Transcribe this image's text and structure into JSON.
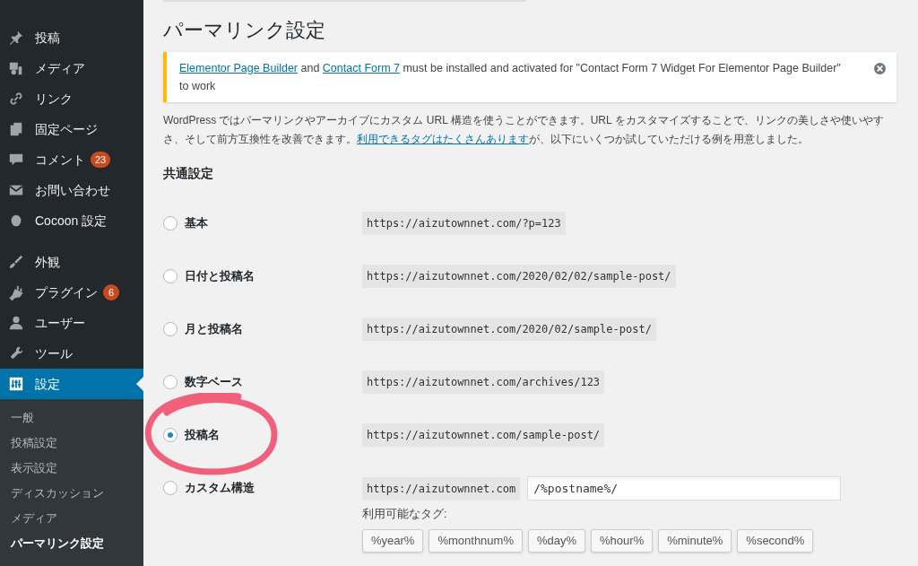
{
  "sidebar": {
    "items": [
      {
        "label": "投稿",
        "selected": false
      },
      {
        "label": "メディア",
        "selected": false
      },
      {
        "label": "リンク",
        "selected": false
      },
      {
        "label": "固定ページ",
        "selected": false
      },
      {
        "label": "コメント",
        "badge": "23",
        "selected": false
      },
      {
        "label": "お問い合わせ",
        "selected": false
      },
      {
        "label": "Cocoon 設定",
        "selected": false
      },
      {
        "label": "外観",
        "selected": false
      },
      {
        "label": "プラグイン",
        "badge": "6",
        "selected": false
      },
      {
        "label": "ユーザー",
        "selected": false
      },
      {
        "label": "ツール",
        "selected": false
      },
      {
        "label": "設定",
        "selected": true
      }
    ],
    "submenu": [
      {
        "label": "一般",
        "selected": false
      },
      {
        "label": "投稿設定",
        "selected": false
      },
      {
        "label": "表示設定",
        "selected": false
      },
      {
        "label": "ディスカッション",
        "selected": false
      },
      {
        "label": "メディア",
        "selected": false
      },
      {
        "label": "パーマリンク設定",
        "selected": true
      }
    ]
  },
  "page_title": "パーマリンク設定",
  "notice": {
    "link_1": "Elementor Page Builder",
    "text_1": "and",
    "link_2": "Contact Form 7",
    "text_2": "must be installed and activated for \"Contact Form 7 Widget For Elementor Page Builder\" to work"
  },
  "intro": {
    "text_1": "WordPress ではパーマリンクやアーカイブにカスタム URL 構造を使うことができます。URL をカスタマイズすることで、リンクの美しさや使いやすさ、そして前方互換性を改善できます。",
    "link": "利用できるタグはたくさんあります",
    "text_2": "が、以下にいくつか試していただける例を用意しました。"
  },
  "section_title": "共通設定",
  "options": [
    {
      "label": "基本",
      "example": "https://aizutownnet.com/?p=123",
      "selected": false
    },
    {
      "label": "日付と投稿名",
      "example": "https://aizutownnet.com/2020/02/02/sample-post/",
      "selected": false
    },
    {
      "label": "月と投稿名",
      "example": "https://aizutownnet.com/2020/02/sample-post/",
      "selected": false
    },
    {
      "label": "数字ベース",
      "example": "https://aizutownnet.com/archives/123",
      "selected": false
    },
    {
      "label": "投稿名",
      "example": "https://aizutownnet.com/sample-post/",
      "selected": true
    },
    {
      "label": "カスタム構造",
      "example": "https://aizutownnet.com",
      "selected": false,
      "kind": "custom",
      "value": "/%postname%/"
    }
  ],
  "tags_label": "利用可能なタグ:",
  "tags": [
    "%year%",
    "%monthnum%",
    "%day%",
    "%hour%",
    "%minute%",
    "%second%"
  ]
}
